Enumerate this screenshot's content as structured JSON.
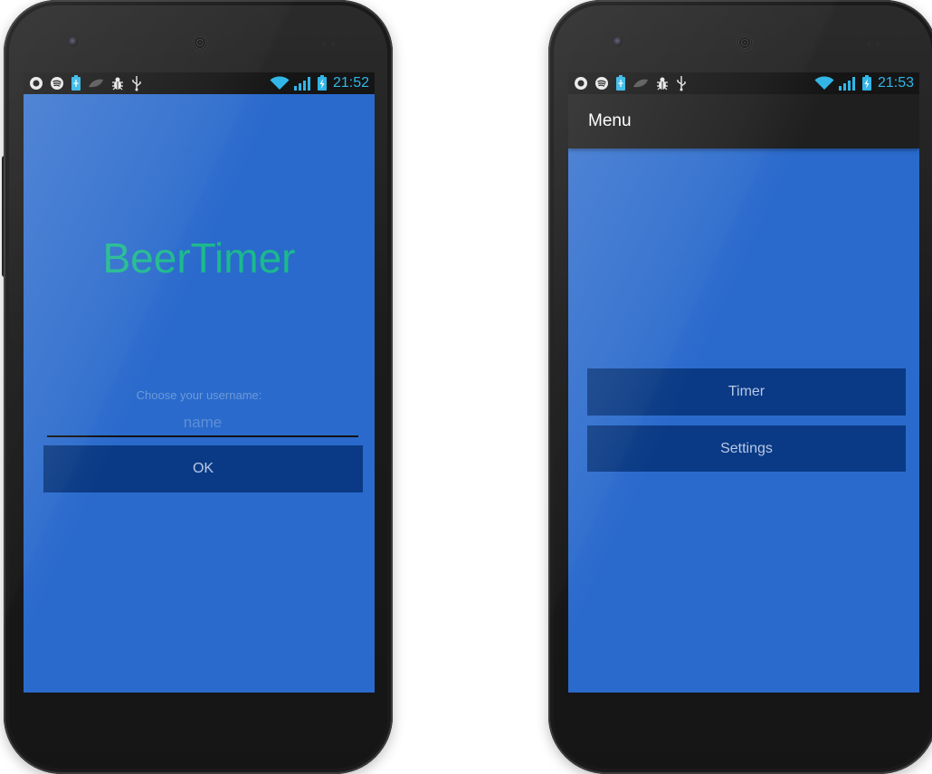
{
  "colors": {
    "screen_bg": "#2a6acc",
    "button_bg": "#0a3a85",
    "title_green": "#1bb98d",
    "status_blue": "#31b6e7"
  },
  "statusbar_icons": [
    "circle-a-icon",
    "spotify-icon",
    "battery-saver-icon",
    "leaf-icon",
    "bug-icon",
    "usb-icon",
    "wifi-icon",
    "signal-icon",
    "battery-charging-icon"
  ],
  "left_screen": {
    "time": "21:52",
    "app_title": "BeerTimer",
    "prompt": "Choose your username:",
    "username_placeholder": "name",
    "username_value": "",
    "ok_label": "OK"
  },
  "right_screen": {
    "time": "21:53",
    "actionbar_title": "Menu",
    "timer_label": "Timer",
    "settings_label": "Settings"
  }
}
